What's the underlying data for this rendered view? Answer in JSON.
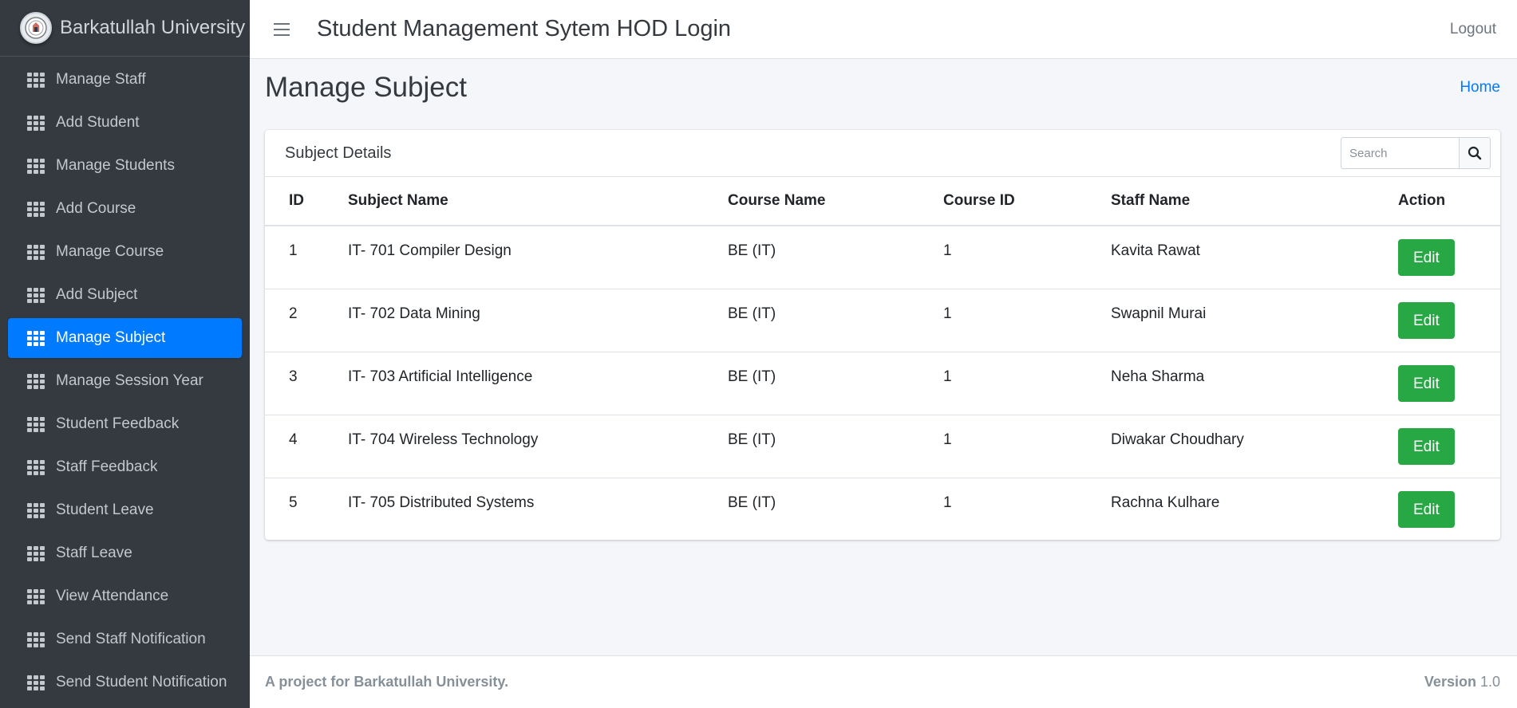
{
  "brand": {
    "name": "Barkatullah University",
    "logo_icon": "university-seal-icon"
  },
  "sidebar": {
    "items": [
      {
        "label": "Manage Staff",
        "active": false
      },
      {
        "label": "Add Student",
        "active": false
      },
      {
        "label": "Manage Students",
        "active": false
      },
      {
        "label": "Add Course",
        "active": false
      },
      {
        "label": "Manage Course",
        "active": false
      },
      {
        "label": "Add Subject",
        "active": false
      },
      {
        "label": "Manage Subject",
        "active": true
      },
      {
        "label": "Manage Session Year",
        "active": false
      },
      {
        "label": "Student Feedback",
        "active": false
      },
      {
        "label": "Staff Feedback",
        "active": false
      },
      {
        "label": "Student Leave",
        "active": false
      },
      {
        "label": "Staff Leave",
        "active": false
      },
      {
        "label": "View Attendance",
        "active": false
      },
      {
        "label": "Send Staff Notification",
        "active": false
      },
      {
        "label": "Send Student Notification",
        "active": false
      }
    ]
  },
  "header": {
    "title": "Student Management Sytem HOD Login",
    "logout": "Logout"
  },
  "page": {
    "title": "Manage Subject",
    "breadcrumb_home": "Home"
  },
  "card": {
    "title": "Subject Details",
    "search_placeholder": "Search",
    "columns": [
      "ID",
      "Subject Name",
      "Course Name",
      "Course ID",
      "Staff Name",
      "Action"
    ],
    "rows": [
      {
        "id": "1",
        "subject": "IT- 701 Compiler Design",
        "course": "BE (IT)",
        "course_id": "1",
        "staff": "Kavita Rawat",
        "action": "Edit"
      },
      {
        "id": "2",
        "subject": "IT- 702 Data Mining",
        "course": "BE (IT)",
        "course_id": "1",
        "staff": "Swapnil Murai",
        "action": "Edit"
      },
      {
        "id": "3",
        "subject": "IT- 703 Artificial Intelligence",
        "course": "BE (IT)",
        "course_id": "1",
        "staff": "Neha Sharma",
        "action": "Edit"
      },
      {
        "id": "4",
        "subject": "IT- 704 Wireless Technology",
        "course": "BE (IT)",
        "course_id": "1",
        "staff": "Diwakar Choudhary",
        "action": "Edit"
      },
      {
        "id": "5",
        "subject": "IT- 705 Distributed Systems",
        "course": "BE (IT)",
        "course_id": "1",
        "staff": "Rachna Kulhare",
        "action": "Edit"
      }
    ]
  },
  "footer": {
    "text": "A project for Barkatullah University.",
    "version_label": "Version",
    "version_number": "1.0"
  },
  "colors": {
    "sidebar_bg": "#343a40",
    "active": "#007bff",
    "edit_button": "#28a745",
    "link": "#007bff"
  }
}
